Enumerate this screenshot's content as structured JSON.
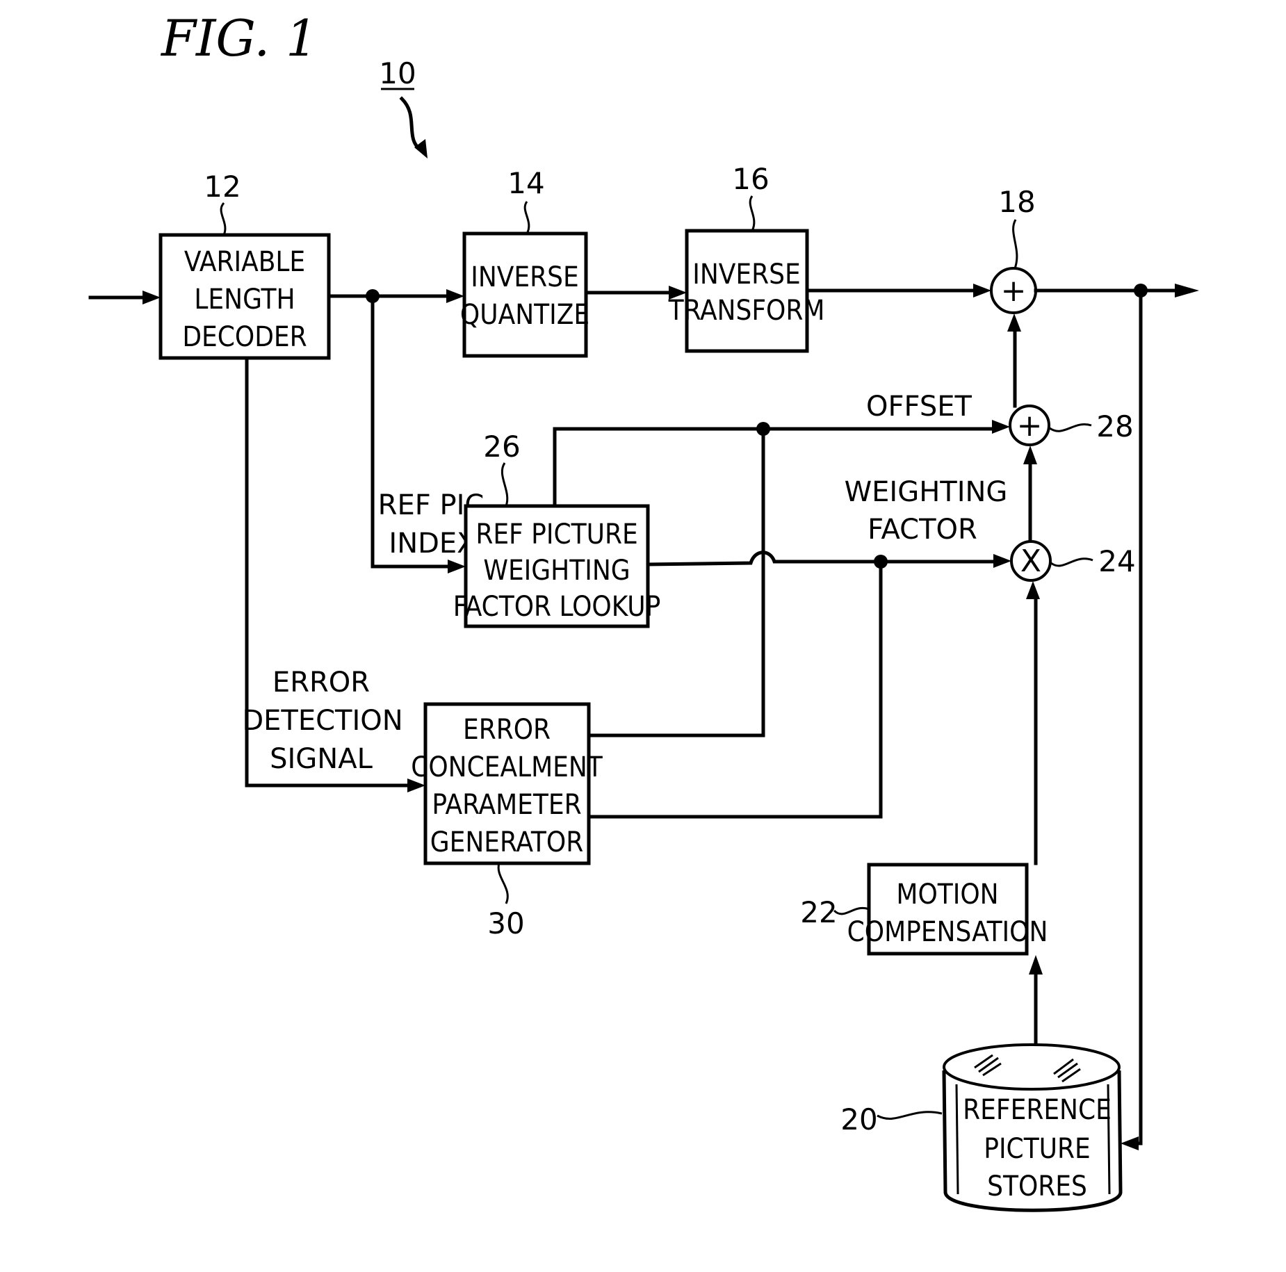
{
  "figure": {
    "title": "FIG. 1",
    "system_ref": "10"
  },
  "blocks": {
    "vld": {
      "ref": "12",
      "lines": [
        "VARIABLE",
        "LENGTH",
        "DECODER"
      ]
    },
    "iq": {
      "ref": "14",
      "lines": [
        "INVERSE",
        "QUANTIZE"
      ]
    },
    "it": {
      "ref": "16",
      "lines": [
        "INVERSE",
        "TRANSFORM"
      ]
    },
    "rpwfl": {
      "ref": "26",
      "lines": [
        "REF PICTURE",
        "WEIGHTING",
        "FACTOR LOOKUP"
      ]
    },
    "ecpg": {
      "ref": "30",
      "lines": [
        "ERROR",
        "CONCEALMENT",
        "PARAMETER",
        "GENERATOR"
      ]
    },
    "mc": {
      "ref": "22",
      "lines": [
        "MOTION",
        "COMPENSATION"
      ]
    },
    "rps": {
      "ref": "20",
      "lines": [
        "REFERENCE",
        "PICTURE",
        "STORES"
      ]
    }
  },
  "nodes": {
    "adder_main": {
      "ref": "18",
      "symbol": "+"
    },
    "adder_offset": {
      "ref": "28",
      "symbol": "+"
    },
    "multiplier": {
      "ref": "24",
      "symbol": "X"
    }
  },
  "signals": {
    "ref_pic_index": [
      "REF PIC",
      "INDEX"
    ],
    "offset": "OFFSET",
    "weighting_factor": [
      "WEIGHTING",
      "FACTOR"
    ],
    "error_detection": [
      "ERROR",
      "DETECTION",
      "SIGNAL"
    ]
  }
}
